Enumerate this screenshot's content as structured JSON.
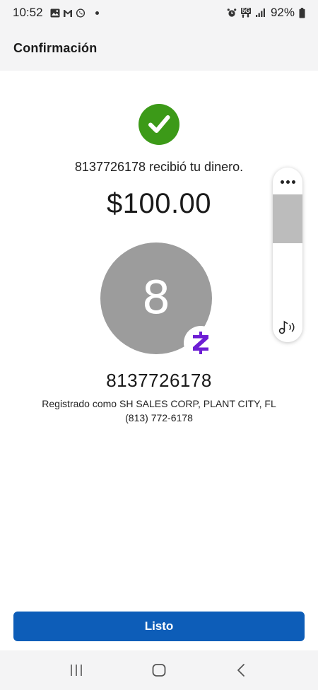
{
  "status_bar": {
    "time": "10:52",
    "battery": "92%",
    "network": "5G"
  },
  "header": {
    "title": "Confirmación"
  },
  "confirmation": {
    "received_message": "8137726178 recibió tu dinero.",
    "amount": "$100.00"
  },
  "recipient": {
    "avatar_initial": "8",
    "name": "8137726178",
    "registered_as": "Registrado como SH SALES CORP, PLANT CITY, FL",
    "phone": "(813) 772-6178"
  },
  "volume_panel": {
    "level": 0.45
  },
  "actions": {
    "done_label": "Listo"
  },
  "colors": {
    "success": "#3c9a18",
    "primary": "#0d5db8",
    "zelle_purple": "#6d1ed4",
    "avatar_bg": "#9c9c9c"
  },
  "icons": {
    "check": "check-icon",
    "zelle": "zelle-logo-icon",
    "volume_sound": "music-note-icon"
  }
}
